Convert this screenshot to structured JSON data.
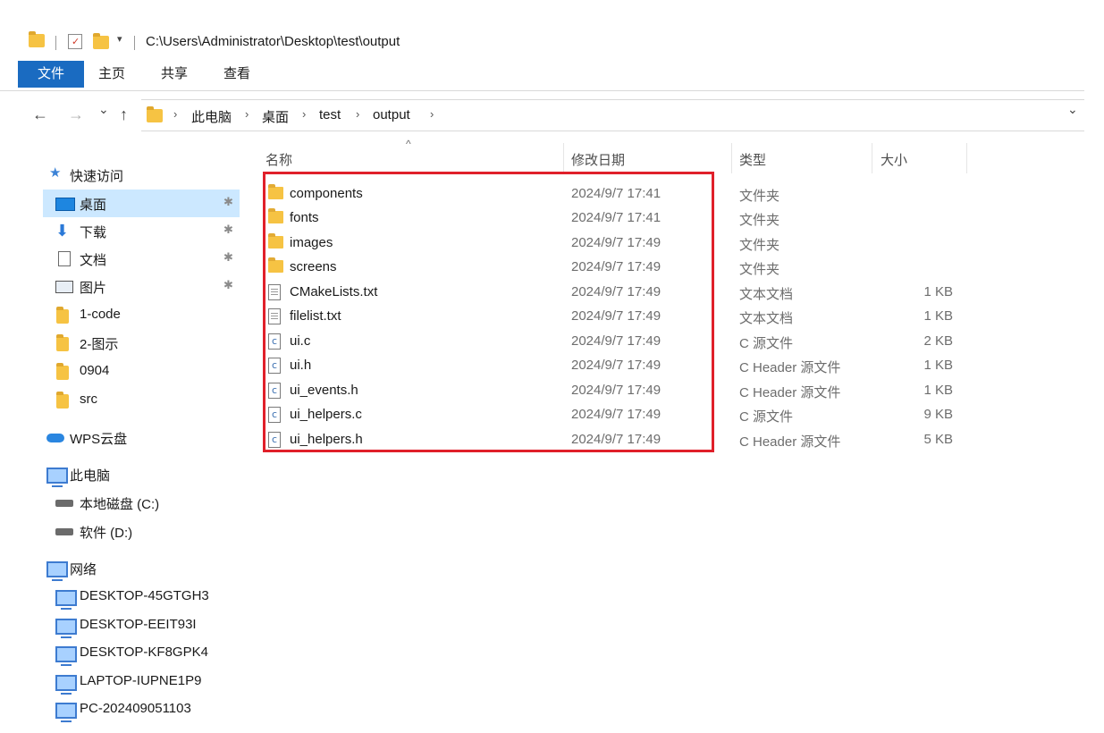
{
  "window": {
    "path": "C:\\Users\\Administrator\\Desktop\\test\\output"
  },
  "ribbon": {
    "file": "文件",
    "home": "主页",
    "share": "共享",
    "view": "查看"
  },
  "nav": {
    "back": "←",
    "forward": "→",
    "recent": "⌄",
    "up": "↑",
    "expand": "⌄",
    "breadcrumb": [
      "此电脑",
      "桌面",
      "test",
      "output"
    ]
  },
  "sidebar": {
    "quick_access": "快速访问",
    "quick_items": [
      {
        "label": "桌面",
        "icon": "desktop-icon",
        "pinned": true,
        "selected": true
      },
      {
        "label": "下载",
        "icon": "download-icon",
        "pinned": true
      },
      {
        "label": "文档",
        "icon": "documents-icon",
        "pinned": true
      },
      {
        "label": "图片",
        "icon": "pictures-icon",
        "pinned": true
      },
      {
        "label": "1-code",
        "icon": "folder-icon"
      },
      {
        "label": "2-图示",
        "icon": "folder-icon"
      },
      {
        "label": "0904",
        "icon": "folder-icon"
      },
      {
        "label": "src",
        "icon": "folder-icon"
      }
    ],
    "wps": "WPS云盘",
    "this_pc": "此电脑",
    "drives": [
      "本地磁盘 (C:)",
      "软件 (D:)"
    ],
    "network": "网络",
    "computers": [
      "DESKTOP-45GTGH3",
      "DESKTOP-EEIT93I",
      "DESKTOP-KF8GPK4",
      "LAPTOP-IUPNE1P9",
      "PC-202409051103"
    ],
    "pin_glyph": "📌"
  },
  "columns": {
    "name": "名称",
    "date": "修改日期",
    "type": "类型",
    "size": "大小",
    "sort_glyph": "^"
  },
  "files": [
    {
      "name": "components",
      "date": "2024/9/7 17:41",
      "type": "文件夹",
      "size": "",
      "icon": "folder-icon"
    },
    {
      "name": "fonts",
      "date": "2024/9/7 17:41",
      "type": "文件夹",
      "size": "",
      "icon": "folder-icon"
    },
    {
      "name": "images",
      "date": "2024/9/7 17:49",
      "type": "文件夹",
      "size": "",
      "icon": "folder-icon"
    },
    {
      "name": "screens",
      "date": "2024/9/7 17:49",
      "type": "文件夹",
      "size": "",
      "icon": "folder-icon"
    },
    {
      "name": "CMakeLists.txt",
      "date": "2024/9/7 17:49",
      "type": "文本文档",
      "size": "1 KB",
      "icon": "text-file-icon"
    },
    {
      "name": "filelist.txt",
      "date": "2024/9/7 17:49",
      "type": "文本文档",
      "size": "1 KB",
      "icon": "text-file-icon"
    },
    {
      "name": "ui.c",
      "date": "2024/9/7 17:49",
      "type": "C 源文件",
      "size": "2 KB",
      "icon": "c-file-icon"
    },
    {
      "name": "ui.h",
      "date": "2024/9/7 17:49",
      "type": "C Header 源文件",
      "size": "1 KB",
      "icon": "c-file-icon"
    },
    {
      "name": "ui_events.h",
      "date": "2024/9/7 17:49",
      "type": "C Header 源文件",
      "size": "1 KB",
      "icon": "c-file-icon"
    },
    {
      "name": "ui_helpers.c",
      "date": "2024/9/7 17:49",
      "type": "C 源文件",
      "size": "9 KB",
      "icon": "c-file-icon"
    },
    {
      "name": "ui_helpers.h",
      "date": "2024/9/7 17:49",
      "type": "C Header 源文件",
      "size": "5 KB",
      "icon": "c-file-icon"
    }
  ],
  "colors": {
    "accent": "#1a6bc1",
    "selection": "#cce8ff",
    "highlight_border": "#e0202a",
    "folder": "#f6c343"
  }
}
